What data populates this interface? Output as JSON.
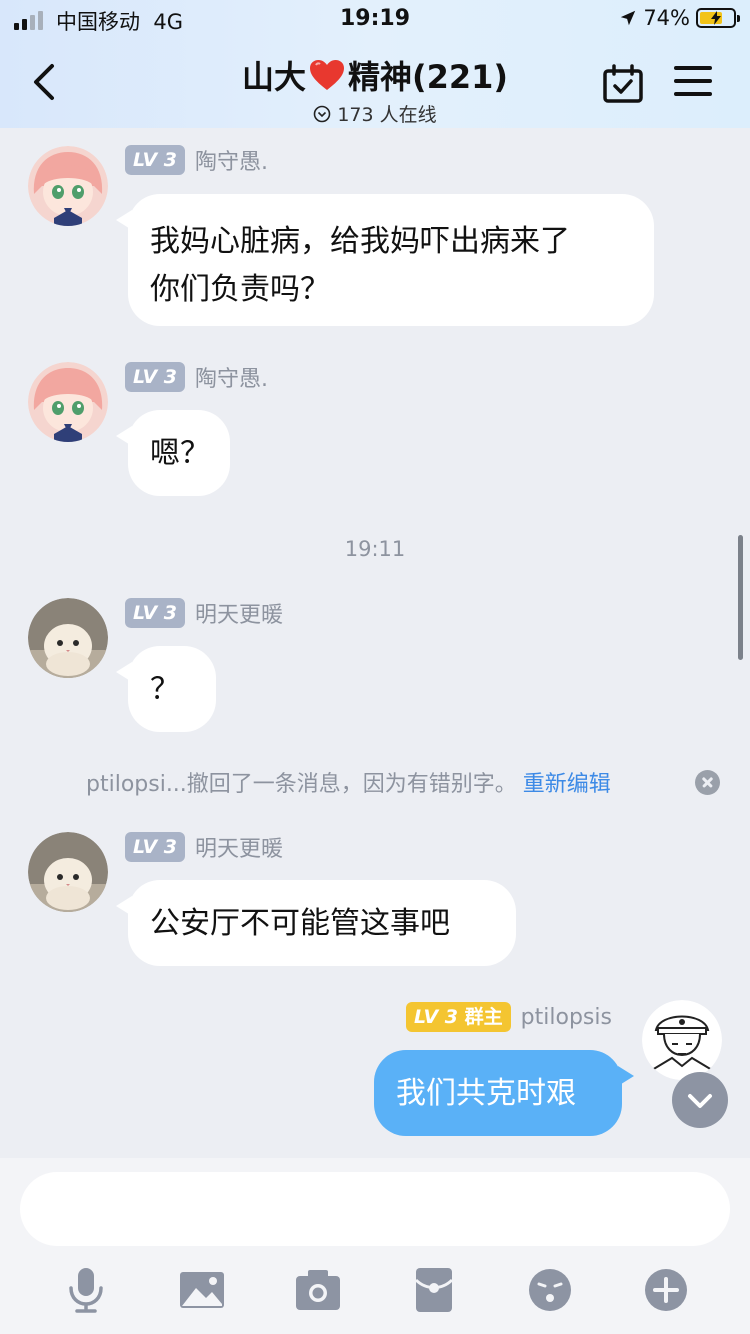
{
  "status_bar": {
    "carrier": "中国移动",
    "network": "4G",
    "time": "19:19",
    "battery_percent": "74%",
    "battery_level": 0.74,
    "signal_bars": 2
  },
  "header": {
    "title_prefix": "山大",
    "title_suffix": "精神(221)",
    "online_text": "173 人在线"
  },
  "messages": [
    {
      "level": "LV 3",
      "sender": "陶守愚.",
      "line1": "我妈心脏病，给我妈吓出病来了",
      "line2": "你们负责吗？"
    },
    {
      "level": "LV 3",
      "sender": "陶守愚.",
      "text": "嗯？"
    },
    {
      "level": "LV 3",
      "sender": "明天更暖",
      "text": "？"
    },
    {
      "level": "LV 3",
      "sender": "明天更暖",
      "text": "公安厅不可能管这事吧"
    }
  ],
  "timestamp": "19:11",
  "recall_notice": {
    "text": "ptilopsi...撤回了一条消息，因为有错别字。",
    "action": "重新编辑"
  },
  "own_message": {
    "level": "LV 3",
    "role": "群主",
    "sender": "ptilopsis",
    "text": "我们共克时艰"
  },
  "composer": {
    "placeholder": ""
  },
  "icons": {
    "back": "chevron-left-icon",
    "calendar": "calendar-check-icon",
    "menu": "hamburger-menu-icon",
    "tools": [
      "microphone-icon",
      "image-icon",
      "camera-icon",
      "red-packet-icon",
      "emoji-icon",
      "plus-icon"
    ]
  },
  "colors": {
    "own_bubble": "#5ab1f7",
    "level_badge": "#a9b3c7",
    "owner_badge": "#f4c531",
    "link": "#3d8ae6",
    "heart": "#e8382f"
  }
}
